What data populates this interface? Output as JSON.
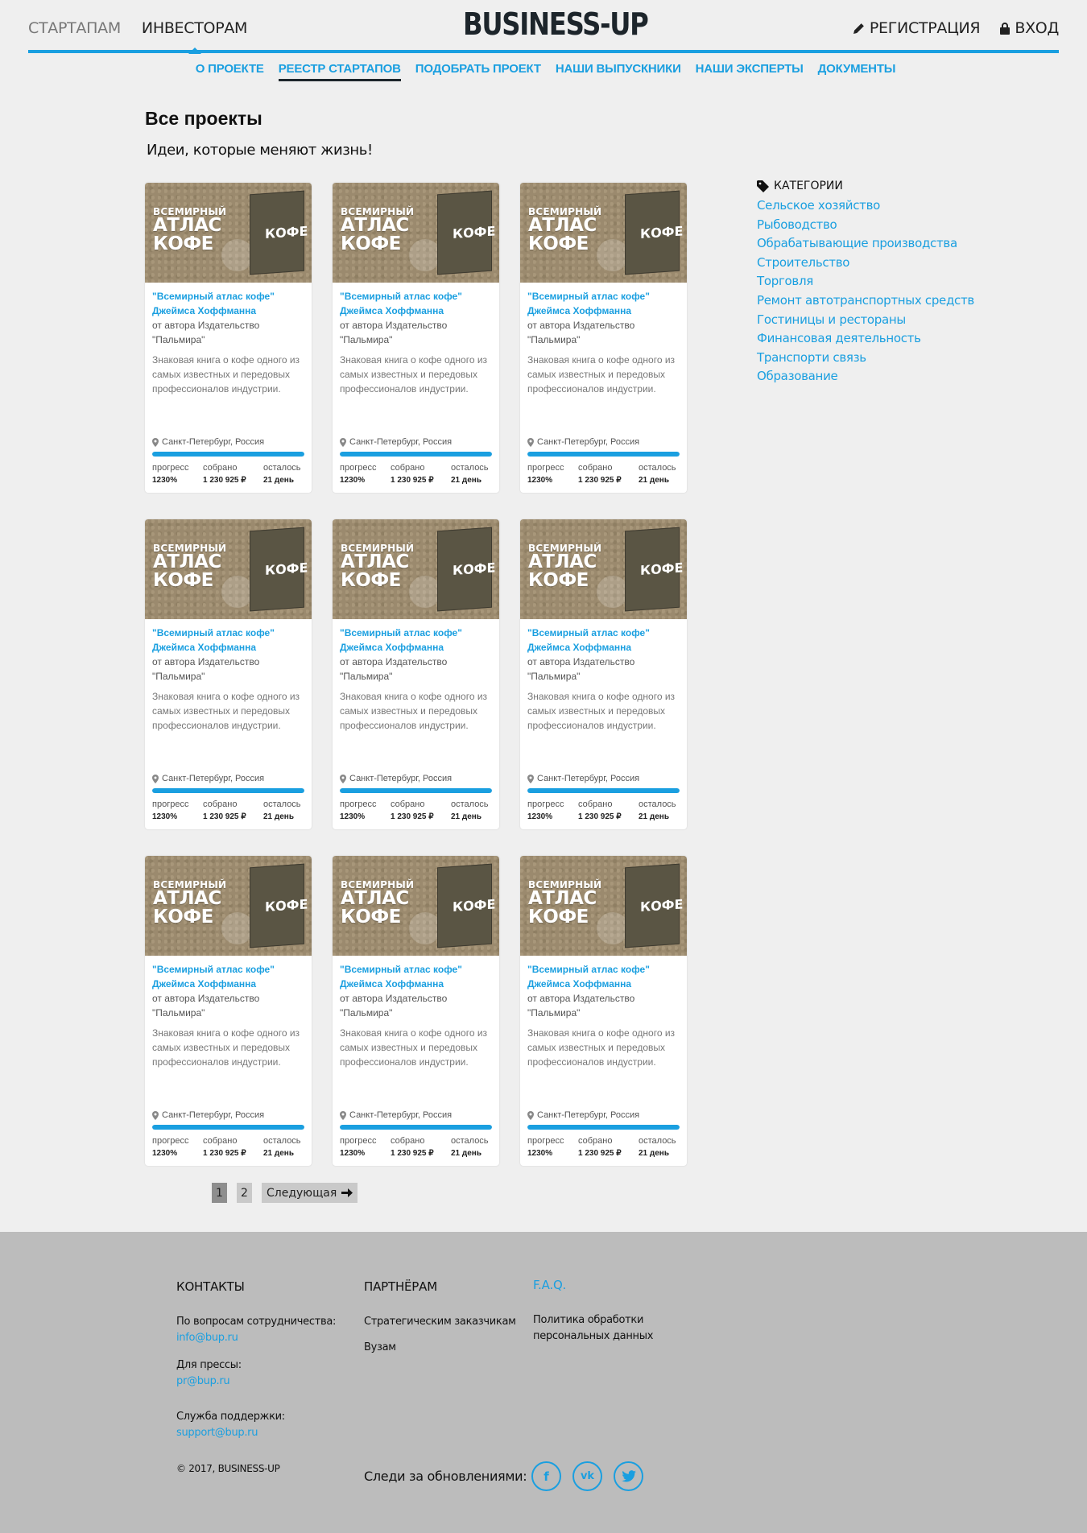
{
  "header": {
    "nav": [
      {
        "label": "СТАРТАПАМ"
      },
      {
        "label": "ИНВЕСТОРАМ"
      }
    ],
    "logo": "BUSINESS-UP",
    "register_label": "РЕГИСТРАЦИЯ",
    "login_label": "ВХОД"
  },
  "subnav": [
    {
      "label": "О ПРОЕКТЕ"
    },
    {
      "label": "РЕЕСТР СТАРТАПОВ"
    },
    {
      "label": "ПОДОБРАТЬ ПРОЕКТ"
    },
    {
      "label": "НАШИ ВЫПУСКНИКИ"
    },
    {
      "label": "НАШИ ЭКСПЕРТЫ"
    },
    {
      "label": "ДОКУМЕНТЫ"
    }
  ],
  "main": {
    "title": "Все проекты",
    "subtitle": "Идеи, которые меняют жизнь!"
  },
  "card": {
    "image_line1": "ВСЕМИРНЫЙ",
    "image_line2": "АТЛАС",
    "image_line3": "КОФЕ",
    "book_title": "КОФЕ",
    "title_line1": "\"Всемирный атлас кофе\"",
    "title_line2": "Джеймса Хоффманна",
    "author_line1": "от автора Издательство",
    "author_line2": "\"Пальмира\"",
    "desc_line1": "Знаковая книга о кофе одного из",
    "desc_line2": "самых известных и передовых",
    "desc_line3": "профессионалов индустрии.",
    "location": "Санкт-Петербург, Россия",
    "progress_fraction": 1.0,
    "progress_label": "прогресс",
    "progress_value": "1230%",
    "collected_label": "собрано",
    "collected_value": "1 230 925 ₽",
    "left_label": "осталось",
    "left_value": "21 день"
  },
  "pagination": {
    "page1": "1",
    "page2": "2",
    "next": "Следующая"
  },
  "sidebar": {
    "heading": "КАТЕГОРИИ",
    "categories": [
      "Сельское хозяйство",
      "Рыбоводство",
      "Обрабатывающие производства",
      "Строительство",
      "Торговля",
      "Ремонт автотранспортных средств",
      "Гостиницы и рестораны",
      "Финансовая деятельность",
      "Транспорти связь",
      "Образование"
    ]
  },
  "footer": {
    "contacts_head": "КОНТАКТЫ",
    "coop_label": "По вопросам сотрудничества:",
    "coop_email": "info@bup.ru",
    "press_label": "Для прессы:",
    "press_email": "pr@bup.ru",
    "support_label": "Служба поддержки:",
    "support_email": "support@bup.ru",
    "copyright": "© 2017, BUSINESS-UP",
    "partners_head": "ПАРТНЁРАМ",
    "partners_link1": "Стратегическим заказчикам",
    "partners_link2": "Вузам",
    "faq_head": "F.A.Q.",
    "policy_line1": "Политика обработки",
    "policy_line2": "персональных данных",
    "follow_label": "Следи за обновлениями:"
  },
  "colors": {
    "accent": "#1a9fe0",
    "footer_bg": "#bcbcbc",
    "page_bg": "#efefef"
  }
}
